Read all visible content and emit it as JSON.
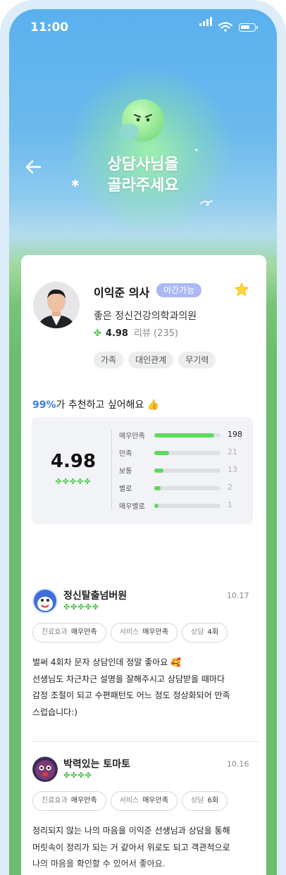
{
  "status_bar": {
    "time": "11:00"
  },
  "header": {
    "title_line1": "상담사님을",
    "title_line2": "골라주세요"
  },
  "doctor": {
    "name": "이익준 의사",
    "badge": "야간가능",
    "clinic": "좋은 정신건강의학과의원",
    "rating": "4.98",
    "reviews": "리뷰 (235)",
    "tags": [
      "가족",
      "대인관계",
      "무기력"
    ]
  },
  "recommend": {
    "percent": "99%",
    "text": "가 추천하고 싶어해요",
    "emoji": "👍"
  },
  "summary": {
    "score": "4.98",
    "stars": "✤✤✤✤✤",
    "rows": [
      {
        "label": "매우만족",
        "count": 198,
        "fraction": 0.9
      },
      {
        "label": "만족",
        "count": 21,
        "fraction": 0.22
      },
      {
        "label": "보통",
        "count": 13,
        "fraction": 0.14
      },
      {
        "label": "별로",
        "count": 2,
        "fraction": 0.1
      },
      {
        "label": "매우별로",
        "count": 1,
        "fraction": 0.06
      }
    ]
  },
  "reviews": [
    {
      "name": "정신탈출넘버원",
      "date": "10.17",
      "stars": "✤✤✤✤✤",
      "chips": [
        {
          "k": "진료효과",
          "v": "매우만족"
        },
        {
          "k": "서비스",
          "v": "매우만족"
        },
        {
          "k": "상담",
          "v": "4회"
        }
      ],
      "lines": [
        "벌써 4회차 문자 상담인데 정말 좋아요 🥰",
        "선생님도 차근차근 설명을 잘해주시고 상담받을 때마다",
        "감정 조절이 되고 수편패턴도 어느 정도 정상화되어 만족",
        "스럽습니다:)"
      ]
    },
    {
      "name": "박력있는 토마토",
      "date": "10.16",
      "stars": "✤✤✤✤",
      "chips": [
        {
          "k": "진료효과",
          "v": "매우만족"
        },
        {
          "k": "서비스",
          "v": "매우만족"
        },
        {
          "k": "상담",
          "v": "6회"
        }
      ],
      "lines": [
        "정리되지 않는 나의 마음을 이익준 선생님과 상담을 통해",
        "머릿속이 정리가 되는 거 같아서 위로도 되고 객관적으로",
        "나의 마음을 확인할 수 있어서 좋아요."
      ]
    }
  ],
  "colors": {
    "accent_green": "#5ed95e",
    "badge": "#aab9f3",
    "recommend_blue": "#3b7fe2"
  }
}
